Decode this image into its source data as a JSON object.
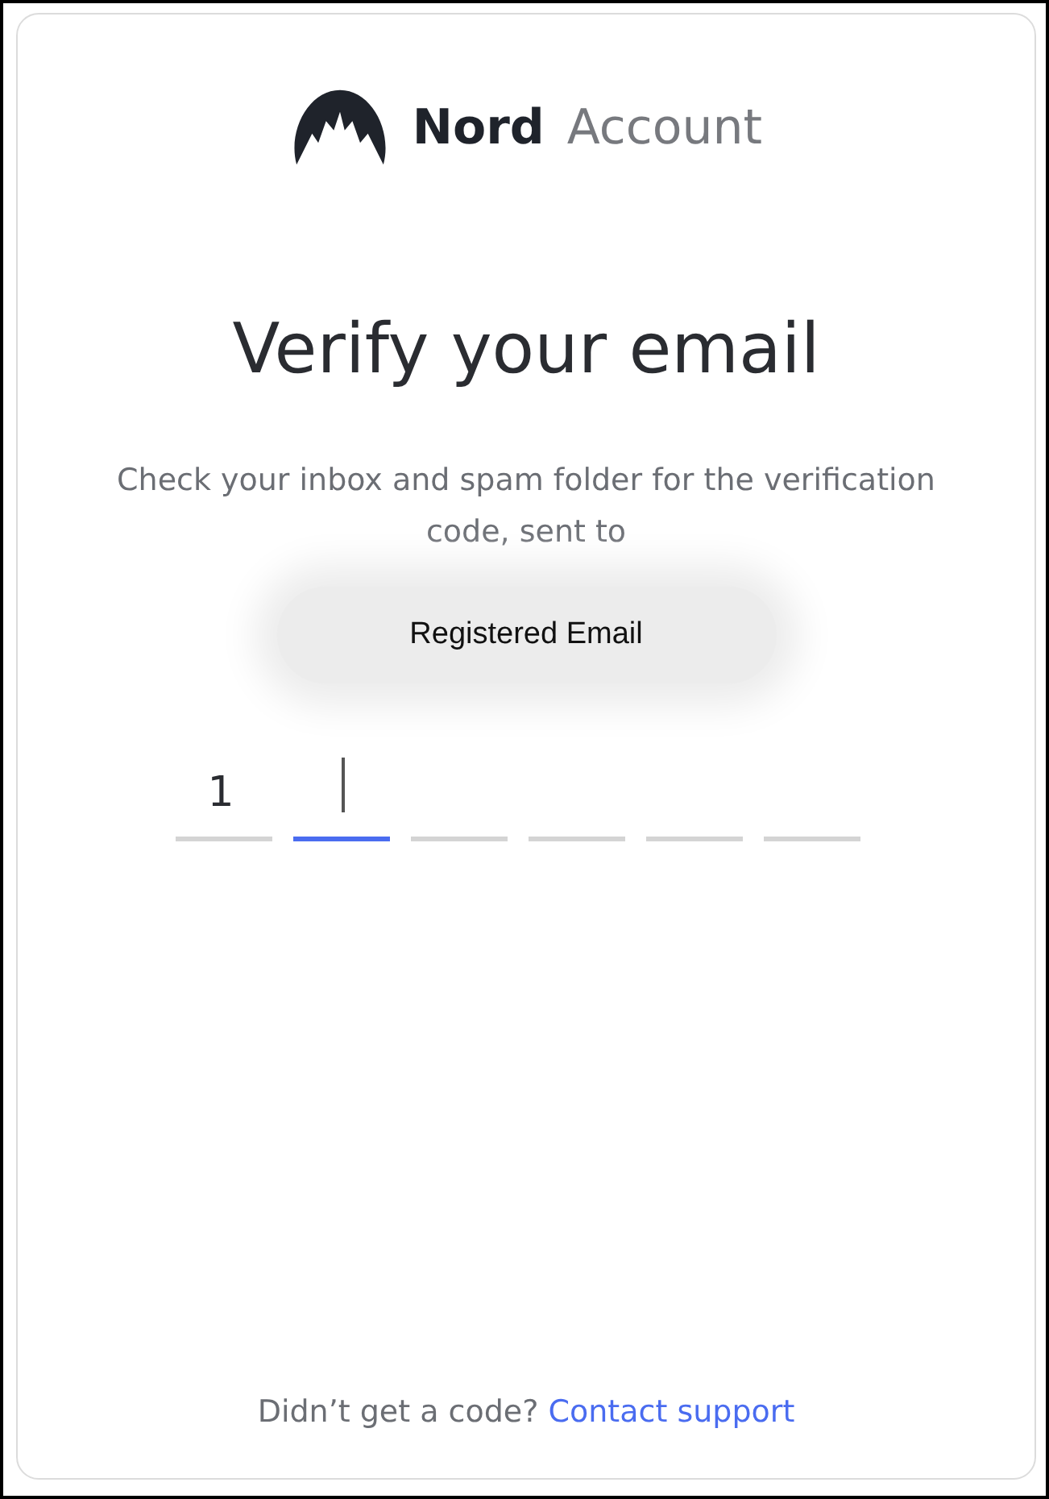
{
  "brand": {
    "name": "Nord",
    "product": "Account"
  },
  "title": "Verify your email",
  "message": "Check your inbox and spam folder for the verification code, sent to",
  "email_badge": "Registered Email",
  "code": {
    "cells": [
      {
        "value": "1",
        "selected": false
      },
      {
        "selected": true
      },
      {
        "selected": false
      },
      {
        "selected": false
      },
      {
        "selected": false
      },
      {
        "selected": false
      }
    ]
  },
  "footer": {
    "text": "Didn’t get a code?",
    "link": "Contact support"
  }
}
